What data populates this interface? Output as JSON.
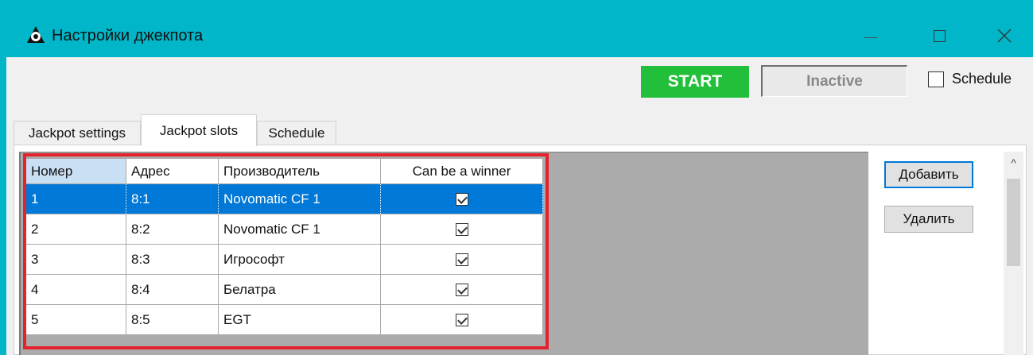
{
  "window": {
    "title": "Настройки джекпота"
  },
  "toolbar": {
    "start_label": "START",
    "status_value": "Inactive",
    "schedule_label": "Schedule",
    "schedule_checked": false
  },
  "tabs": [
    {
      "label": "Jackpot settings",
      "active": false
    },
    {
      "label": "Jackpot slots",
      "active": true
    },
    {
      "label": "Schedule",
      "active": false
    }
  ],
  "grid": {
    "columns": [
      "Номер",
      "Адрес",
      "Производитель",
      "Can be a winner"
    ],
    "rows": [
      {
        "num": "1",
        "addr": "8:1",
        "manufacturer": "Novomatic CF 1",
        "can_win": true
      },
      {
        "num": "2",
        "addr": "8:2",
        "manufacturer": "Novomatic CF 1",
        "can_win": true
      },
      {
        "num": "3",
        "addr": "8:3",
        "manufacturer": "Игрософт",
        "can_win": true
      },
      {
        "num": "4",
        "addr": "8:4",
        "manufacturer": "Белатра",
        "can_win": true
      },
      {
        "num": "5",
        "addr": "8:5",
        "manufacturer": "EGT",
        "can_win": true
      }
    ]
  },
  "side_buttons": {
    "add_label": "Добавить",
    "delete_label": "Удалить"
  },
  "colors": {
    "titlebar": "#00b6c8",
    "start": "#22c03a",
    "selection": "#0078d7",
    "highlight": "#e3222d"
  },
  "icons": {
    "app": "jackpot-app-icon",
    "scroll": "chevron-up-icon"
  }
}
